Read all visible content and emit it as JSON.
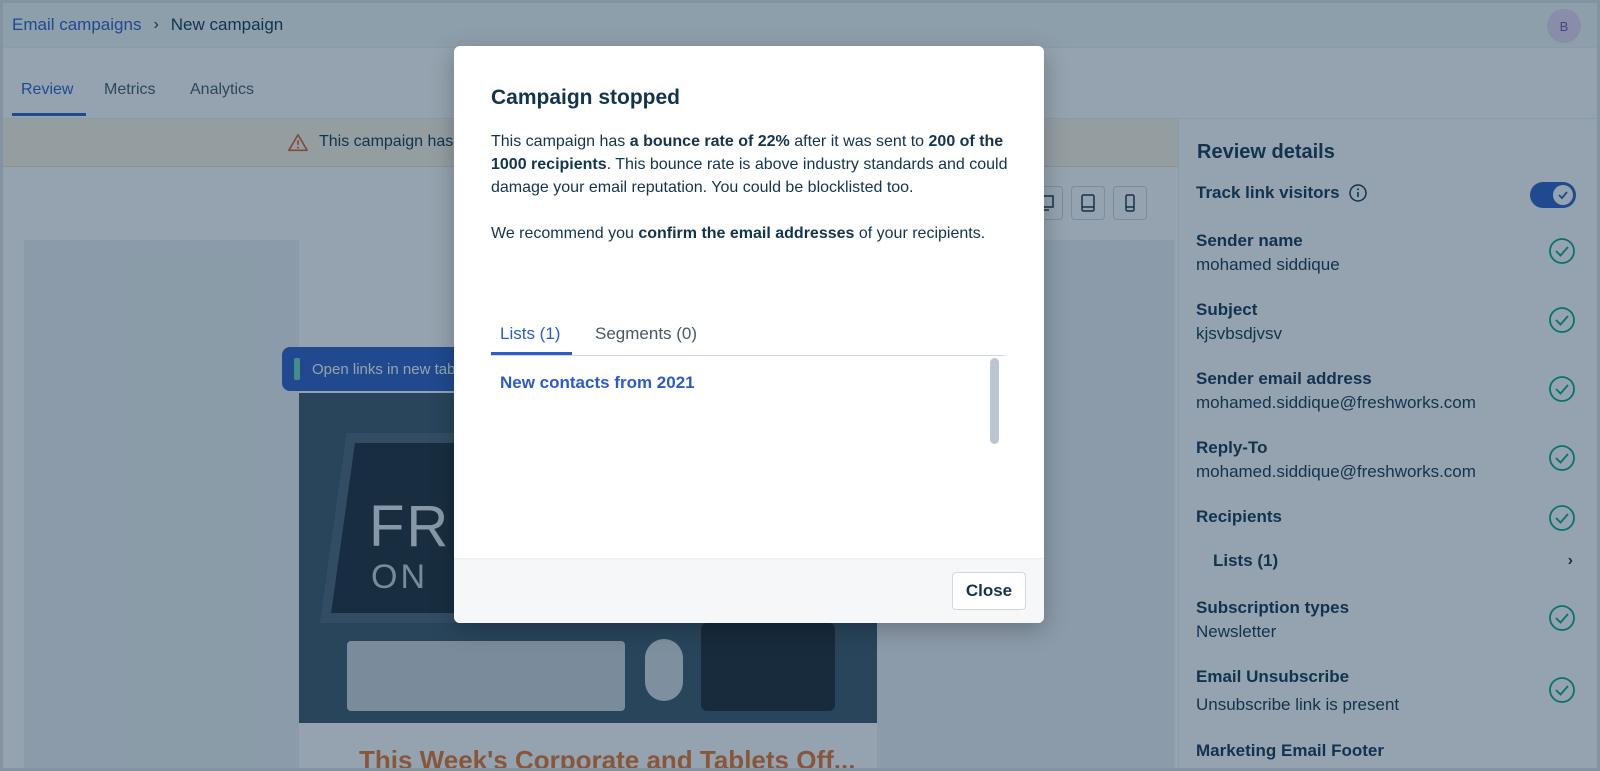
{
  "breadcrumb": {
    "parent": "Email campaigns",
    "separator": "›",
    "current": "New campaign"
  },
  "avatar": {
    "initial": "B"
  },
  "tabs": [
    {
      "label": "Review",
      "active": true
    },
    {
      "label": "Metrics",
      "active": false
    },
    {
      "label": "Analytics",
      "active": false
    }
  ],
  "banner": {
    "text": "This campaign has",
    "icon": "warning-icon"
  },
  "floating_chip": {
    "label": "Open links in new tab"
  },
  "email_preview": {
    "hero_line1": "FREE",
    "hero_line2": "ON",
    "heading": "This Week's Corporate and Tablets Off..."
  },
  "review": {
    "title": "Review details",
    "track_link_visitors": "Track link visitors",
    "items": [
      {
        "label": "Sender name",
        "value": "mohamed siddique"
      },
      {
        "label": "Subject",
        "value": "kjsvbsdjvsv"
      },
      {
        "label": "Sender email address",
        "value": "mohamed.siddique@freshworks.com"
      },
      {
        "label": "Reply-To",
        "value": "mohamed.siddique@freshworks.com"
      },
      {
        "label": "Recipients",
        "value": ""
      },
      {
        "label": "Subscription types",
        "value": "Newsletter"
      },
      {
        "label": "Email Unsubscribe",
        "value": "Unsubscribe link is present"
      },
      {
        "label": "Marketing Email Footer",
        "value": ""
      }
    ],
    "lists_label": "Lists (1)",
    "lists_chevron": "›"
  },
  "modal": {
    "title": "Campaign stopped",
    "p1_a": "This campaign has ",
    "p1_b": "a bounce rate of 22%",
    "p1_c": " after it was sent to ",
    "p1_d": "200 of the 1000 recipients",
    "p1_e": ". This bounce rate is above industry standards and could damage your email reputation. You could be blocklisted too.",
    "p2_a": "We recommend you ",
    "p2_b": "confirm the email addresses",
    "p2_c": " of your recipients.",
    "tab_lists": "Lists (1)",
    "tab_segments": "Segments (0)",
    "list_items": [
      "New contacts from 2021"
    ],
    "close_label": "Close"
  },
  "colors": {
    "accent": "#2c5cc5",
    "text": "#12344d",
    "success": "#00a886",
    "warning": "#e8742d"
  }
}
